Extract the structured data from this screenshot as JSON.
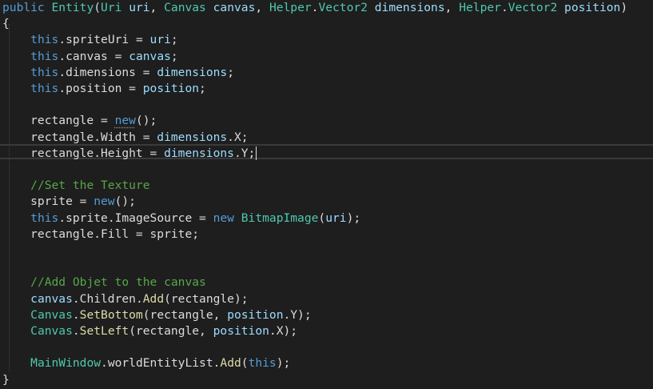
{
  "editor": {
    "colors": {
      "background": "#1e1e1e",
      "keyword": "#569cd6",
      "type": "#4ec9b0",
      "method": "#dcdcaa",
      "parameter": "#9cdcfe",
      "text": "#dcdcdc",
      "comment": "#57a64a"
    },
    "lines": [
      [
        [
          "kw",
          "public "
        ],
        [
          "type",
          "Entity"
        ],
        [
          "plain",
          "("
        ],
        [
          "type",
          "Uri"
        ],
        [
          "plain",
          " "
        ],
        [
          "param",
          "uri"
        ],
        [
          "plain",
          ", "
        ],
        [
          "type",
          "Canvas"
        ],
        [
          "plain",
          " "
        ],
        [
          "param",
          "canvas"
        ],
        [
          "plain",
          ", "
        ],
        [
          "type",
          "Helper"
        ],
        [
          "plain",
          "."
        ],
        [
          "type",
          "Vector2"
        ],
        [
          "plain",
          " "
        ],
        [
          "param",
          "dimensions"
        ],
        [
          "plain",
          ", "
        ],
        [
          "type",
          "Helper"
        ],
        [
          "plain",
          "."
        ],
        [
          "type",
          "Vector2"
        ],
        [
          "plain",
          " "
        ],
        [
          "param",
          "position"
        ],
        [
          "plain",
          ")"
        ]
      ],
      [
        [
          "plain",
          "{"
        ]
      ],
      [
        [
          "plain",
          "    "
        ],
        [
          "kw",
          "this"
        ],
        [
          "plain",
          ".spriteUri = "
        ],
        [
          "param",
          "uri"
        ],
        [
          "plain",
          ";"
        ]
      ],
      [
        [
          "plain",
          "    "
        ],
        [
          "kw",
          "this"
        ],
        [
          "plain",
          ".canvas = "
        ],
        [
          "param",
          "canvas"
        ],
        [
          "plain",
          ";"
        ]
      ],
      [
        [
          "plain",
          "    "
        ],
        [
          "kw",
          "this"
        ],
        [
          "plain",
          ".dimensions = "
        ],
        [
          "param",
          "dimensions"
        ],
        [
          "plain",
          ";"
        ]
      ],
      [
        [
          "plain",
          "    "
        ],
        [
          "kw",
          "this"
        ],
        [
          "plain",
          ".position = "
        ],
        [
          "param",
          "position"
        ],
        [
          "plain",
          ";"
        ]
      ],
      [],
      [
        [
          "plain",
          "    rectangle = "
        ],
        [
          "kw squiggle",
          "new"
        ],
        [
          "plain",
          "();"
        ]
      ],
      [
        [
          "plain",
          "    rectangle.Width = "
        ],
        [
          "param",
          "dimensions"
        ],
        [
          "plain",
          ".X;"
        ]
      ],
      [
        [
          "plain",
          "    rectangle.Height = "
        ],
        [
          "param",
          "dimensions"
        ],
        [
          "plain",
          ".Y;"
        ]
      ],
      [],
      [
        [
          "plain",
          "    "
        ],
        [
          "comment",
          "//Set the Texture"
        ]
      ],
      [
        [
          "plain",
          "    sprite = "
        ],
        [
          "kw",
          "new"
        ],
        [
          "plain",
          "();"
        ]
      ],
      [
        [
          "plain",
          "    "
        ],
        [
          "kw",
          "this"
        ],
        [
          "plain",
          ".sprite.ImageSource = "
        ],
        [
          "kw",
          "new"
        ],
        [
          "plain",
          " "
        ],
        [
          "type",
          "BitmapImage"
        ],
        [
          "plain",
          "("
        ],
        [
          "param",
          "uri"
        ],
        [
          "plain",
          ");"
        ]
      ],
      [
        [
          "plain",
          "    rectangle.Fill = sprite;"
        ]
      ],
      [],
      [],
      [
        [
          "plain",
          "    "
        ],
        [
          "comment",
          "//Add Objet to the canvas"
        ]
      ],
      [
        [
          "plain",
          "    "
        ],
        [
          "param",
          "canvas"
        ],
        [
          "plain",
          ".Children."
        ],
        [
          "method",
          "Add"
        ],
        [
          "plain",
          "(rectangle);"
        ]
      ],
      [
        [
          "plain",
          "    "
        ],
        [
          "type",
          "Canvas"
        ],
        [
          "plain",
          "."
        ],
        [
          "method",
          "SetBottom"
        ],
        [
          "plain",
          "(rectangle, "
        ],
        [
          "param",
          "position"
        ],
        [
          "plain",
          ".Y);"
        ]
      ],
      [
        [
          "plain",
          "    "
        ],
        [
          "type",
          "Canvas"
        ],
        [
          "plain",
          "."
        ],
        [
          "method",
          "SetLeft"
        ],
        [
          "plain",
          "(rectangle, "
        ],
        [
          "param",
          "position"
        ],
        [
          "plain",
          ".X);"
        ]
      ],
      [],
      [
        [
          "plain",
          "    "
        ],
        [
          "type",
          "MainWindow"
        ],
        [
          "plain",
          ".worldEntityList."
        ],
        [
          "method",
          "Add"
        ],
        [
          "plain",
          "("
        ],
        [
          "kw",
          "this"
        ],
        [
          "plain",
          ");"
        ]
      ],
      [
        [
          "plain",
          "}"
        ]
      ]
    ],
    "cursor_line": 10
  }
}
